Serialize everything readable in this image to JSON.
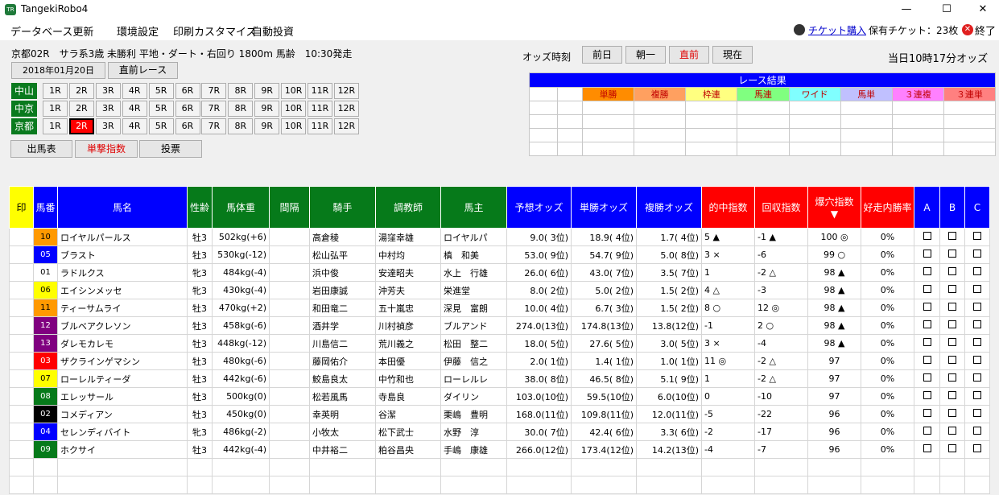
{
  "window": {
    "title": "TangekiRobo4",
    "icon_text": "TR",
    "minimize": "—",
    "maximize": "☐",
    "close": "✕"
  },
  "menu": {
    "items": [
      "データベース更新",
      "環境設定",
      "印刷カスタマイズ",
      "自動投資"
    ],
    "ticket_link": "チケット購入",
    "ticket_count": "保有チケット：23枚",
    "exit": "終了"
  },
  "race": {
    "info": "京都02R　サラ系3歳 未勝利 平地・ダート・右回り 1800m 馬齢　10:30発走",
    "date": "2018年01月20日",
    "prev_race_button": "直前レース"
  },
  "venues": [
    {
      "name": "中山",
      "races": [
        "1R",
        "2R",
        "3R",
        "4R",
        "5R",
        "6R",
        "7R",
        "8R",
        "9R",
        "10R",
        "11R",
        "12R"
      ]
    },
    {
      "name": "中京",
      "races": [
        "1R",
        "2R",
        "3R",
        "4R",
        "5R",
        "6R",
        "7R",
        "8R",
        "9R",
        "10R",
        "11R",
        "12R"
      ]
    },
    {
      "name": "京都",
      "races": [
        "1R",
        "2R",
        "3R",
        "4R",
        "5R",
        "6R",
        "7R",
        "8R",
        "9R",
        "10R",
        "11R",
        "12R"
      ],
      "selected": "2R"
    }
  ],
  "view_buttons": [
    "出馬表",
    "単撃指数",
    "投票"
  ],
  "odds": {
    "label": "オッズ時刻",
    "buttons": [
      "前日",
      "朝一",
      "直前",
      "現在"
    ],
    "current": "当日10時17分オッズ"
  },
  "results": {
    "title": "レース結果",
    "headers": [
      "単勝",
      "複勝",
      "枠連",
      "馬連",
      "ワイド",
      "馬単",
      "３連複",
      "３連単"
    ],
    "header_colors": [
      "#ff8c00",
      "#ffa060",
      "#ffff80",
      "#80ff80",
      "#80ffff",
      "#c0c0ff",
      "#ff80ff",
      "#ff8080"
    ]
  },
  "table": {
    "headers": [
      "印",
      "馬番",
      "馬名",
      "性齢",
      "馬体重",
      "間隔",
      "騎手",
      "調教師",
      "馬主",
      "予想オッズ",
      "単勝オッズ",
      "複勝オッズ",
      "的中指数",
      "回収指数",
      "爆穴指数",
      "好走内勝率",
      "A",
      "B",
      "C"
    ],
    "sort_indicator": "▼",
    "rows": [
      {
        "num": "10",
        "color": "#ff9900",
        "textcolor": "#000",
        "name": "ロイヤルパールス",
        "sex": "牡3",
        "weight": "502kg(+6)",
        "jockey": "高倉稜",
        "trainer": "湯窪幸雄",
        "owner": "ロイヤルパ",
        "yoso": "9.0( 3位)",
        "tan": "18.9( 4位)",
        "fuku": "1.7( 4位)",
        "hit": "5 ▲",
        "kai": "-1 ▲",
        "baku": "100 ◎",
        "rate": "0%"
      },
      {
        "num": "05",
        "color": "#0000ff",
        "textcolor": "#fff",
        "name": "ブラスト",
        "sex": "牡3",
        "weight": "530kg(-12)",
        "jockey": "松山弘平",
        "trainer": "中村均",
        "owner": "槙　和美",
        "yoso": "53.0( 9位)",
        "tan": "54.7( 9位)",
        "fuku": "5.0( 8位)",
        "hit": "3 ×",
        "kai": "-6",
        "baku": "99 ○",
        "rate": "0%"
      },
      {
        "num": "01",
        "color": "#ffffff",
        "textcolor": "#000",
        "name": "ラドルクス",
        "sex": "牝3",
        "weight": "484kg(-4)",
        "jockey": "浜中俊",
        "trainer": "安達昭夫",
        "owner": "水上　行雄",
        "yoso": "26.0( 6位)",
        "tan": "43.0( 7位)",
        "fuku": "3.5( 7位)",
        "hit": "1",
        "kai": "-2 △",
        "baku": "98 ▲",
        "rate": "0%"
      },
      {
        "num": "06",
        "color": "#ffff00",
        "textcolor": "#000",
        "name": "エイシンメッセ",
        "sex": "牝3",
        "weight": "430kg(-4)",
        "jockey": "岩田康誠",
        "trainer": "沖芳夫",
        "owner": "栄進堂",
        "yoso": "8.0( 2位)",
        "tan": "5.0( 2位)",
        "fuku": "1.5( 2位)",
        "hit": "4 △",
        "kai": "-3",
        "baku": "98 ▲",
        "rate": "0%"
      },
      {
        "num": "11",
        "color": "#ff9900",
        "textcolor": "#000",
        "name": "ティーサムライ",
        "sex": "牡3",
        "weight": "470kg(+2)",
        "jockey": "和田竜二",
        "trainer": "五十嵐忠",
        "owner": "深見　富朗",
        "yoso": "10.0( 4位)",
        "tan": "6.7( 3位)",
        "fuku": "1.5( 2位)",
        "hit": "8 ○",
        "kai": "12 ◎",
        "baku": "98 ▲",
        "rate": "0%"
      },
      {
        "num": "12",
        "color": "#800080",
        "textcolor": "#fff",
        "name": "ブルベアクレソン",
        "sex": "牡3",
        "weight": "458kg(-6)",
        "jockey": "酒井学",
        "trainer": "川村禎彦",
        "owner": "ブルアンド",
        "yoso": "274.0(13位)",
        "tan": "174.8(13位)",
        "fuku": "13.8(12位)",
        "hit": "-1",
        "kai": "2 ○",
        "baku": "98 ▲",
        "rate": "0%"
      },
      {
        "num": "13",
        "color": "#800080",
        "textcolor": "#fff",
        "name": "ダレモカレモ",
        "sex": "牡3",
        "weight": "448kg(-12)",
        "jockey": "川島信二",
        "trainer": "荒川義之",
        "owner": "松田　整二",
        "yoso": "18.0( 5位)",
        "tan": "27.6( 5位)",
        "fuku": "3.0( 5位)",
        "hit": "3 ×",
        "kai": "-4",
        "baku": "98 ▲",
        "rate": "0%"
      },
      {
        "num": "03",
        "color": "#ff0000",
        "textcolor": "#fff",
        "name": "ザクラインゲマシン",
        "sex": "牡3",
        "weight": "480kg(-6)",
        "jockey": "藤岡佑介",
        "trainer": "本田優",
        "owner": "伊藤　信之",
        "yoso": "2.0( 1位)",
        "tan": "1.4( 1位)",
        "fuku": "1.0( 1位)",
        "hit": "11 ◎",
        "kai": "-2 △",
        "baku": "97",
        "rate": "0%"
      },
      {
        "num": "07",
        "color": "#ffff00",
        "textcolor": "#000",
        "name": "ローレルティーダ",
        "sex": "牡3",
        "weight": "442kg(-6)",
        "jockey": "鮫島良太",
        "trainer": "中竹和也",
        "owner": "ローレルレ",
        "yoso": "38.0( 8位)",
        "tan": "46.5( 8位)",
        "fuku": "5.1( 9位)",
        "hit": "1",
        "kai": "-2 △",
        "baku": "97",
        "rate": "0%"
      },
      {
        "num": "08",
        "color": "#067a1a",
        "textcolor": "#fff",
        "name": "エレッサール",
        "sex": "牡3",
        "weight": "500kg(0)",
        "jockey": "松若風馬",
        "trainer": "寺島良",
        "owner": "ダイリン",
        "yoso": "103.0(10位)",
        "tan": "59.5(10位)",
        "fuku": "6.0(10位)",
        "hit": "0",
        "kai": "-10",
        "baku": "97",
        "rate": "0%"
      },
      {
        "num": "02",
        "color": "#000000",
        "textcolor": "#fff",
        "name": "コメディアン",
        "sex": "牡3",
        "weight": "450kg(0)",
        "jockey": "幸英明",
        "trainer": "谷潔",
        "owner": "栗嶋　豊明",
        "yoso": "168.0(11位)",
        "tan": "109.8(11位)",
        "fuku": "12.0(11位)",
        "hit": "-5",
        "kai": "-22",
        "baku": "96",
        "rate": "0%"
      },
      {
        "num": "04",
        "color": "#0000ff",
        "textcolor": "#fff",
        "name": "セレンディバイト",
        "sex": "牝3",
        "weight": "486kg(-2)",
        "jockey": "小牧太",
        "trainer": "松下武士",
        "owner": "水野　淳",
        "yoso": "30.0( 7位)",
        "tan": "42.4( 6位)",
        "fuku": "3.3( 6位)",
        "hit": "-2",
        "kai": "-17",
        "baku": "96",
        "rate": "0%"
      },
      {
        "num": "09",
        "color": "#067a1a",
        "textcolor": "#fff",
        "name": "ホクサイ",
        "sex": "牡3",
        "weight": "442kg(-4)",
        "jockey": "中井裕二",
        "trainer": "粕谷昌央",
        "owner": "手嶋　康雄",
        "yoso": "266.0(12位)",
        "tan": "173.4(12位)",
        "fuku": "14.2(13位)",
        "hit": "-4",
        "kai": "-7",
        "baku": "96",
        "rate": "0%"
      }
    ]
  }
}
